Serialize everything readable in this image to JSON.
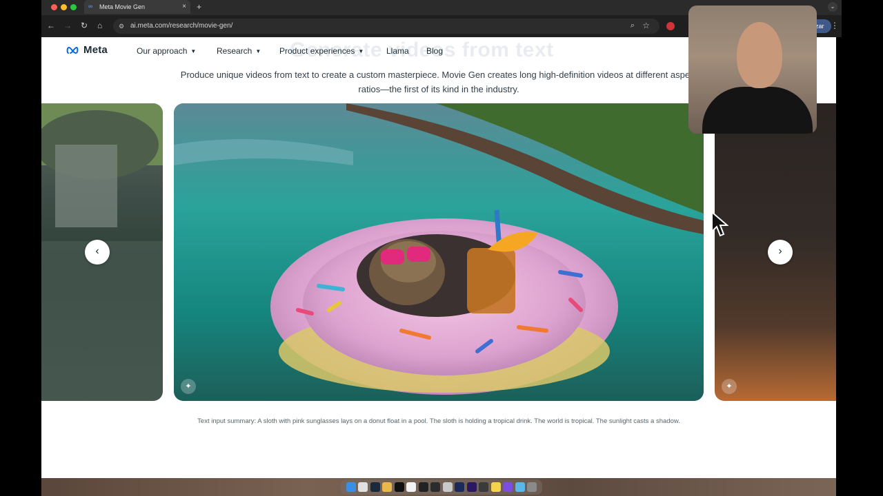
{
  "browser": {
    "tab_title": "Meta Movie Gen",
    "tab_close": "×",
    "new_tab": "+",
    "url": "ai.meta.com/research/movie-gen/",
    "profile_label": "izar",
    "back": "←",
    "forward": "→",
    "reload": "↻",
    "home": "⌂",
    "tab_menu": "⌄",
    "kebab": "⋮"
  },
  "site": {
    "logo_text": "Meta",
    "nav": [
      {
        "label": "Our approach",
        "has_dropdown": true
      },
      {
        "label": "Research",
        "has_dropdown": true
      },
      {
        "label": "Product experiences",
        "has_dropdown": true
      },
      {
        "label": "Llama",
        "has_dropdown": false
      },
      {
        "label": "Blog",
        "has_dropdown": false
      }
    ],
    "ghost_heading": "Generate videos from text",
    "subtitle": "Produce unique videos from text to create a custom masterpiece. Movie Gen creates long high-definition videos at different aspect ratios—the first of its kind in the industry.",
    "carousel": {
      "prev": "‹",
      "next": "›",
      "caption": "Text input summary: A sloth with pink sunglasses lays on a donut float in a pool. The sloth is holding a tropical drink. The world is tropical. The sunlight casts a shadow."
    }
  },
  "colors": {
    "brand_blue": "#0668e1",
    "text_dark": "#1c2b33"
  },
  "icons": {
    "chevron": "chevron-down-icon",
    "generated_badge": "sparkle-icon"
  }
}
